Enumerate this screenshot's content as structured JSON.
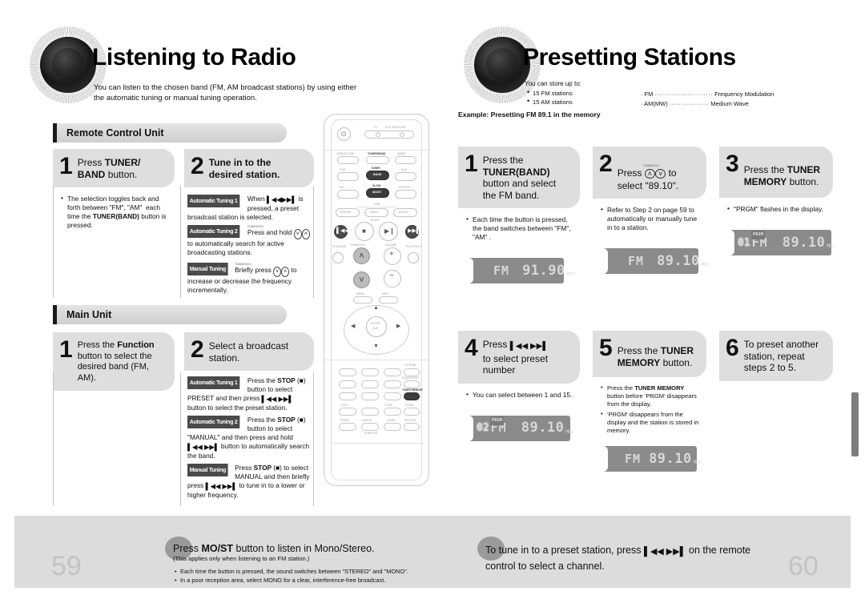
{
  "left_page": {
    "title": "Listening to Radio",
    "lede": "You can listen to the chosen band (FM, AM broadcast stations) by using either the automatic tuning or manual tuning operation.",
    "sections": [
      {
        "heading": "Remote Control Unit",
        "steps": [
          {
            "number": "1",
            "text_parts": [
              "Press ",
              "TUNER/",
              "BAND",
              " button."
            ],
            "text_plain": "Press TUNER/BAND button.",
            "bullets": [
              "The selection toggles back and forth between \"FM\", \"AM\"  each time the TUNER(BAND) button is pressed."
            ]
          },
          {
            "number": "2",
            "text_plain": "Tune in to the desired station.",
            "tags": [
              {
                "label": "Automatic Tuning 1",
                "text": "When ❙◀◀ ▶▶❙ is pressed, a preset broadcast station is selected."
              },
              {
                "label": "Automatic Tuning 2",
                "text": "Press and hold ⓪⓪ to automatically search for active broadcasting stations.",
                "knob": "TUNING/CH"
              },
              {
                "label": "Manual Tuning",
                "text": "Briefly press ⓪⓪ to increase or decrease the frequency incrementally.",
                "knob": "TUNING/CH"
              }
            ]
          }
        ]
      },
      {
        "heading": "Main Unit",
        "steps": [
          {
            "number": "1",
            "text_plain": "Press the Function button to select the desired band (FM, AM).",
            "bullets": []
          },
          {
            "number": "2",
            "text_plain": "Select a broadcast station.",
            "tags": [
              {
                "label": "Automatic Tuning 1",
                "text": "Press the STOP (■) button to select PRESET and then press ❙◀◀ ▶▶❙ button to select the preset station."
              },
              {
                "label": "Automatic Tuning 2",
                "text": "Press the STOP (■) button to select \"MANUAL\" and then press and hold ❙◀◀ ▶▶❙ button to automatically search the band."
              },
              {
                "label": "Manual Tuning",
                "text": "Press STOP (■) to select MANUAL and then briefly press ❙◀◀ ▶▶❙ to tune in to a lower or higher frequency."
              }
            ]
          }
        ]
      }
    ],
    "page_number": "59"
  },
  "right_page": {
    "title": "Presetting Stations",
    "store_intro": "You can store up to:",
    "store_bullets": [
      "15 FM stations",
      "15 AM stations"
    ],
    "legend": [
      {
        "term": "FM",
        "dots": "·························",
        "def": "Frequency Modulation"
      },
      {
        "term": "AM(MW)",
        "dots": "·················",
        "def": "Medium Wave"
      }
    ],
    "example_label": "Example: Presetting FM 89.1 in the memory",
    "steps": [
      {
        "number": "1",
        "text_plain": "Press the TUNER(BAND) button and select the FM band.",
        "bullets": [
          "Each time the button is pressed, the band switches between \"FM\", \"AM\" ."
        ],
        "display": {
          "preset": "",
          "band": "FM",
          "freq": "91.90",
          "unit": "MHz",
          "prgm": false
        }
      },
      {
        "number": "2",
        "text_plain": "Press ⓪⓪ to select \"89.10\".",
        "knob": "TUNING/CH",
        "bullets": [
          "Refer to Step 2 on page 59 to automatically or manually tune in to a station."
        ],
        "display": {
          "preset": "",
          "band": "FM",
          "freq": "89.10",
          "unit": "MHz",
          "prgm": false
        }
      },
      {
        "number": "3",
        "text_plain": "Press the TUNER MEMORY button.",
        "bullets": [
          "\"PRGM\" flashes in the display."
        ],
        "display": {
          "preset": "01",
          "band": "FM",
          "freq": "89.10",
          "unit": "MHz",
          "prgm": true,
          "prgm_label": "PRGM"
        }
      },
      {
        "number": "4",
        "text_plain": "Press ❙◀◀ ▶▶❙ to select preset number",
        "bullets": [
          "You can select between 1 and 15."
        ],
        "display": {
          "preset": "02",
          "band": "FM",
          "freq": "89.10",
          "unit": "MHz",
          "prgm": true,
          "prgm_label": "PRGM"
        }
      },
      {
        "number": "5",
        "text_plain": "Press the TUNER MEMORY button.",
        "bullets": [
          "Press the TUNER MEMORY button before 'PRGM' disappears from the display.",
          "'PRGM' disappears from the display and the station is stored in memory."
        ],
        "display": {
          "preset": "",
          "band": "FM",
          "freq": "89.10",
          "unit": "MHz",
          "prgm": false
        }
      },
      {
        "number": "6",
        "text_plain": "To preset another station, repeat steps 2 to 5.",
        "bullets": [],
        "display": null
      }
    ],
    "page_number": "60"
  },
  "footer": {
    "left": {
      "title": "Press MO/ST button to listen in Mono/Stereo.",
      "subtitle": "(This applies only when listening to an FM station.)",
      "bullets": [
        "Each time the button is pressed, the sound switches between \"STEREO\" and \"MONO\".",
        "In a poor reception area, select MONO for a clear, interference-free broadcast."
      ]
    },
    "right": {
      "title": "To tune in to a preset station, press ❙◀◀ ▶▶❙ on the remote control to select a channel."
    }
  },
  "remote": {
    "labels": {
      "power": "⏻",
      "tv": "TV",
      "dvd_receiver": "DVD RECEIVER",
      "open_close": "OPEN/CLOSE",
      "tuner_band": "TUNER/BAND",
      "mode": "MODE",
      "dvd": "DVD",
      "tuner": "TUNER",
      "band": "BAND",
      "aux": "AUX",
      "mic": "MIC",
      "slow": "SLOW",
      "most": "MO/ST",
      "crc_dsp": "CRC/DSP",
      "dsm": "DSM",
      "super5": "SUPER5",
      "music": "MUSIC",
      "movie": "MOVIE",
      "ecap": "EC/KP",
      "tuning_ch": "TUNING/CH",
      "volume": "VOLUME",
      "ple_mode": "PLⅡ MODE",
      "ple_effect": "PLⅡ EFFECT",
      "enter": "ENTER",
      "clip": "CLIP",
      "menu": "MENU",
      "info": "INFO",
      "tv_tone": "TV/TONE",
      "sound_edit": "SOUND EDIT",
      "tuner_memory": "TUNER MEMORY",
      "logo": "LOGO",
      "step": "STEP",
      "zoom": "ZOOM",
      "prgm": "PRGM",
      "cancel": "CANCEL",
      "return": "RETURN",
      "subtitle": "SUBTITLE"
    }
  },
  "colors": {
    "card_gray": "#dedede",
    "bar_gray": "#d8d8d8",
    "tag_dark": "#4a4a4a",
    "lcd_gray": "#8b8b8b",
    "footer_gray": "#dcdcdc",
    "pagenum_gray": "#c3c3c3",
    "edge_tab": "#7d7d7d"
  }
}
